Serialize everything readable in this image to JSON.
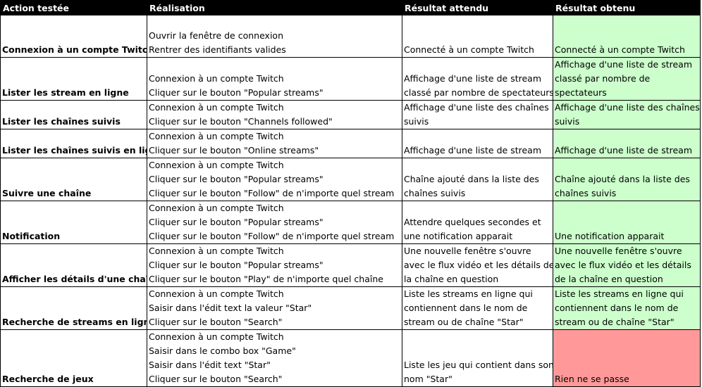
{
  "colors": {
    "header_bg": "#000000",
    "pass": "#ccffcc",
    "fail": "#ff9999"
  },
  "headers": [
    "Action testée",
    "Réalisation",
    "Résultat attendu",
    "Résultat obtenu"
  ],
  "rows": [
    {
      "action": "Connexion à un compte Twitch",
      "steps": [
        "Ouvrir la fenêtre de connexion",
        "Rentrer des identifiants valides"
      ],
      "expected": [
        "Connecté à un compte Twitch"
      ],
      "obtained": [
        "Connecté à un compte Twitch"
      ],
      "status": "pass"
    },
    {
      "action": "Lister les stream en ligne",
      "steps": [
        "Connexion à un compte Twitch",
        "Cliquer sur le bouton \"Popular streams\""
      ],
      "expected": [
        "Affichage d'une liste de stream",
        "classé par nombre de spectateurs"
      ],
      "obtained": [
        "Affichage d'une liste de stream",
        "classé par nombre de",
        "spectateurs"
      ],
      "status": "pass"
    },
    {
      "action": "Lister les chaînes suivis",
      "steps": [
        "Connexion à un compte Twitch",
        "Cliquer sur le bouton \"Channels followed\""
      ],
      "expected": [
        "Affichage d'une liste des chaînes",
        "suivis"
      ],
      "obtained": [
        "Affichage d'une liste des chaînes",
        "suivis"
      ],
      "status": "pass"
    },
    {
      "action": "Lister les chaînes suivis en ligne",
      "steps": [
        "Connexion à un compte Twitch",
        "Cliquer sur le bouton \"Online streams\""
      ],
      "expected": [
        "Affichage d'une liste de stream"
      ],
      "obtained": [
        "Affichage d'une liste de stream"
      ],
      "status": "pass"
    },
    {
      "action": "Suivre une chaîne",
      "steps": [
        "Connexion à un compte Twitch",
        "Cliquer sur le bouton \"Popular streams\"",
        "Cliquer sur le bouton \"Follow\" de n'importe quel stream"
      ],
      "expected": [
        "Chaîne ajouté dans la liste des",
        "chaînes suivis"
      ],
      "obtained": [
        "Chaîne ajouté dans la liste des",
        "chaînes suivis"
      ],
      "status": "pass"
    },
    {
      "action": "Notification",
      "steps": [
        "Connexion à un compte Twitch",
        "Cliquer sur le bouton \"Popular streams\"",
        "Cliquer sur le bouton \"Follow\" de n'importe quel stream"
      ],
      "expected": [
        "Attendre quelques secondes et",
        "une notification apparait"
      ],
      "obtained": [
        "Une notification apparait"
      ],
      "status": "pass"
    },
    {
      "action": "Afficher les détails d'une chaîne",
      "steps": [
        "Connexion à un compte Twitch",
        "Cliquer sur le bouton \"Popular streams\"",
        "Cliquer sur le bouton \"Play\" de n'importe quel chaîne"
      ],
      "expected": [
        "Une nouvelle fenêtre s'ouvre",
        "avec le flux vidéo et les détails de",
        "la chaîne en question"
      ],
      "obtained": [
        "Une nouvelle fenêtre s'ouvre",
        "avec le flux vidéo et les détails",
        "de la chaîne en question"
      ],
      "status": "pass"
    },
    {
      "action": "Recherche de streams en ligne",
      "steps": [
        "Connexion à un compte Twitch",
        "Saisir dans l'édit text la valeur \"Star\"",
        "Cliquer sur le bouton \"Search\""
      ],
      "expected": [
        "Liste les streams en ligne qui",
        "contiennent dans le nom de",
        "stream ou de chaîne \"Star\""
      ],
      "obtained": [
        "Liste les streams en ligne qui",
        "contiennent dans le nom de",
        "stream ou de chaîne \"Star\""
      ],
      "status": "pass"
    },
    {
      "action": "Recherche de jeux",
      "steps": [
        "Connexion à un compte Twitch",
        "Saisir dans le combo box \"Game\"",
        "Saisir dans l'édit text \"Star\"",
        "Cliquer sur le bouton \"Search\""
      ],
      "expected": [
        "Liste les jeu qui contient dans son",
        "nom \"Star\""
      ],
      "obtained": [
        "Rien ne se passe"
      ],
      "status": "fail"
    }
  ]
}
